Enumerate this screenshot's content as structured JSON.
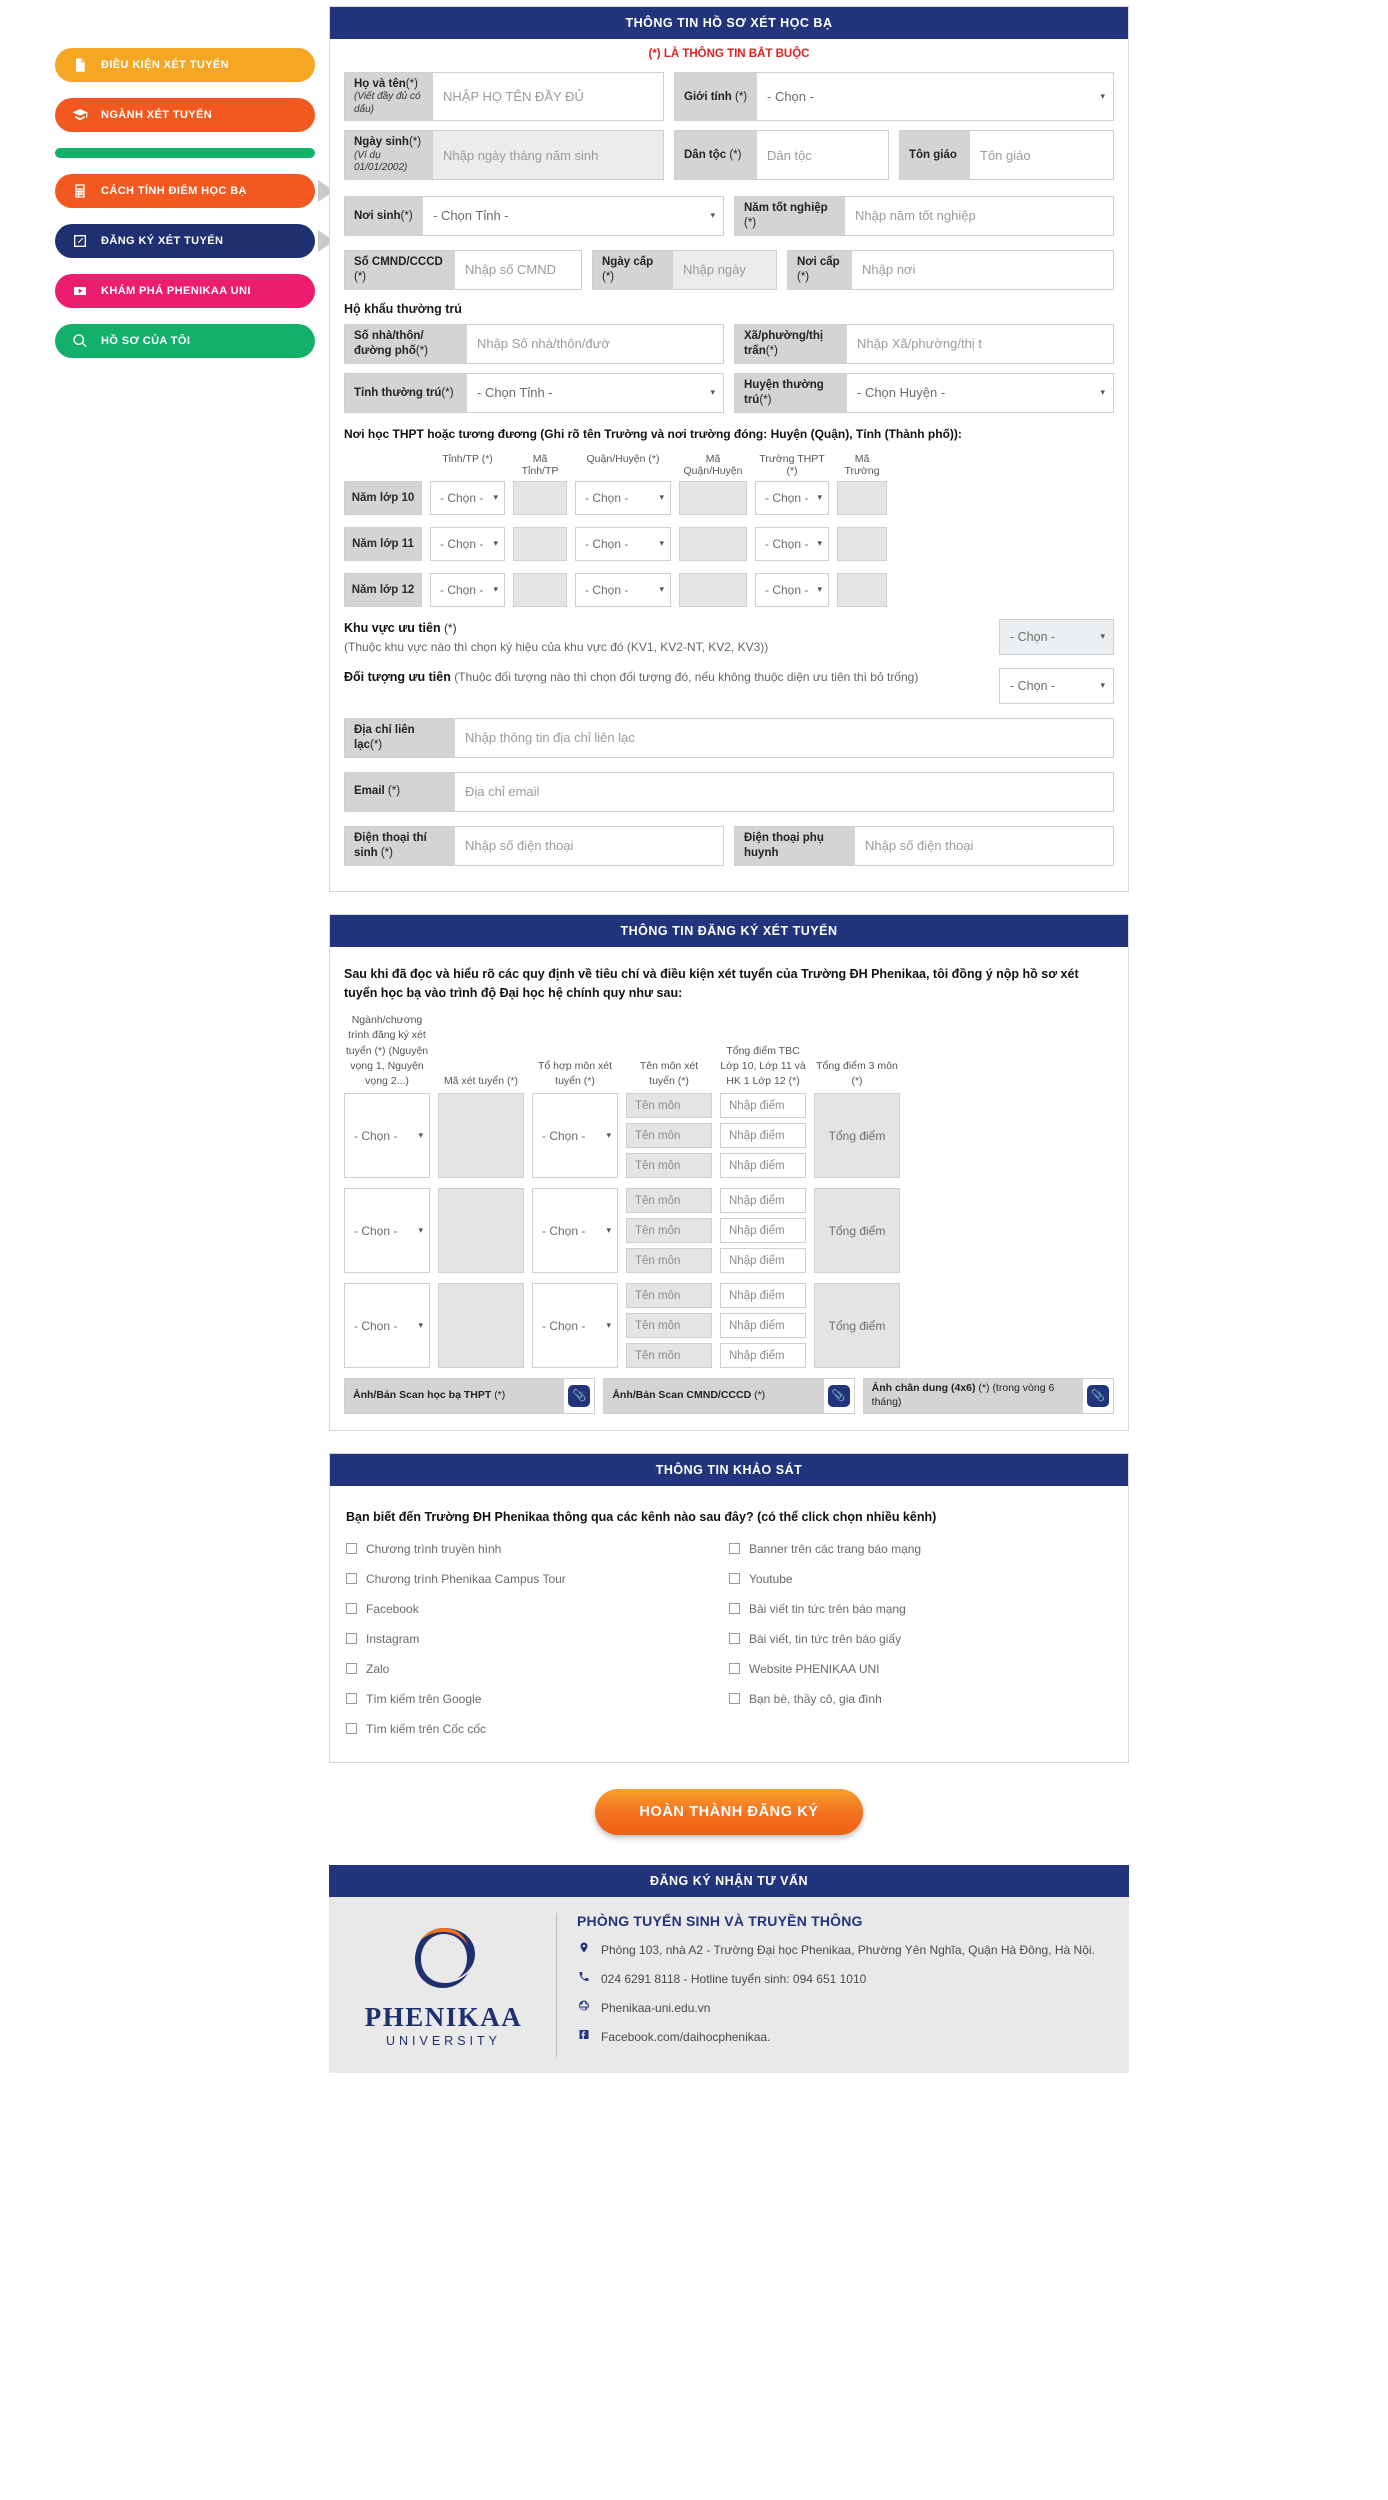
{
  "sidebar": {
    "items": [
      {
        "label": "Điều kiện xét tuyển",
        "icon": "document-icon",
        "color": "amber",
        "pointer": false
      },
      {
        "label": "Ngành xét tuyển",
        "icon": "graduation-cap-icon",
        "color": "orange",
        "pointer": false
      },
      {
        "label": "Cách tính điểm học bạ",
        "icon": "calculator-icon",
        "color": "orange",
        "pointer": true
      },
      {
        "label": "Đăng ký xét tuyển",
        "icon": "edit-pencil-icon",
        "color": "navy",
        "pointer": true
      },
      {
        "label": "Khám phá PHENIKAA UNI",
        "icon": "video-play-icon",
        "color": "pink",
        "pointer": false
      },
      {
        "label": "Hồ sơ của tôi",
        "icon": "search-icon",
        "color": "green",
        "pointer": false
      }
    ]
  },
  "section1": {
    "title": "THÔNG TIN HỒ SƠ XÉT HỌC BẠ",
    "required_note": "(*) LÀ THÔNG TIN BẮT BUỘC",
    "fullname": {
      "label": "Họ và tên",
      "star": "(*)",
      "sub": "(Viết đầy đủ có dấu)",
      "placeholder": "NHẬP HỌ TÊN ĐẦY ĐỦ"
    },
    "gender": {
      "label": "Giới tính",
      "star": "(*)",
      "value": "- Chọn -"
    },
    "birthday": {
      "label": "Ngày sinh",
      "star": "(*)",
      "sub": "(Ví dụ 01/01/2002)",
      "placeholder": "Nhập ngày tháng năm sinh"
    },
    "ethnicity": {
      "label": "Dân tộc",
      "star": "(*)",
      "placeholder": "Dân tộc"
    },
    "religion": {
      "label": "Tôn giáo",
      "star": "",
      "placeholder": "Tôn giáo"
    },
    "birthplace": {
      "label": "Nơi sinh",
      "star": "(*)",
      "value": "- Chọn Tỉnh -"
    },
    "grad_year": {
      "label": "Năm tốt nghiệp",
      "star": "(*)",
      "placeholder": "Nhập năm tốt nghiệp"
    },
    "id_number": {
      "label": "Số CMND/CCCD",
      "star": "(*)",
      "placeholder": "Nhập số CMND"
    },
    "id_date": {
      "label": "Ngày cấp",
      "star": "(*)",
      "placeholder": "Nhập ngày"
    },
    "id_place": {
      "label": "Nơi cấp",
      "star": "(*)",
      "placeholder": "Nhập nơi"
    },
    "residence_title": "Hộ khẩu thường trú",
    "street": {
      "label": "Số nhà/thôn/đường phố",
      "star": "(*)",
      "placeholder": "Nhập Số nhà/thôn/đườ"
    },
    "ward": {
      "label": "Xã/phường/thị trấn",
      "star": "(*)",
      "placeholder": "Nhập Xã/phường/thị t"
    },
    "province": {
      "label": "Tỉnh thường trú",
      "star": "(*)",
      "value": "- Chọn Tỉnh -"
    },
    "district": {
      "label": "Huyện thường trú",
      "star": "(*)",
      "value": "- Chọn Huyện -"
    },
    "school_note": "Nơi học THPT hoặc tương đương (Ghi rõ tên Trường và nơi trường đóng: Huyện (Quận), Tỉnh (Thành phố)):",
    "school_headers": [
      "Tỉnh/TP (*)",
      "Mã Tỉnh/TP",
      "Quận/Huyện (*)",
      "Mã Quận/Huyện",
      "Trường THPT (*)",
      "Mã Trường"
    ],
    "school_rows": [
      {
        "grade": "Năm lớp 10",
        "province": "- Chọn -",
        "district": "- Chọn -",
        "school": "- Chọn -"
      },
      {
        "grade": "Năm lớp 11",
        "province": "- Chọn -",
        "district": "- Chọn -",
        "school": "- Chọn -"
      },
      {
        "grade": "Năm lớp 12",
        "province": "- Chọn -",
        "district": "- Chọn -",
        "school": "- Chọn -"
      }
    ],
    "priority_area": {
      "label": "Khu vực ưu tiên",
      "star": "(*)",
      "hint": "(Thuộc khu vực nào thì chọn ký hiệu của khu vực đó (KV1, KV2-NT, KV2, KV3))",
      "value": "- Chọn -"
    },
    "priority_subject": {
      "label": "Đối tượng ưu tiên",
      "hint": "(Thuộc đối tượng nào thì chọn đối tượng đó, nếu không thuộc diện ưu tiên thì bỏ trống)",
      "value": "- Chọn -"
    },
    "contact_address": {
      "label": "Địa chỉ liên lạc",
      "star": "(*)",
      "placeholder": "Nhập thông tin địa chỉ liên lạc"
    },
    "email": {
      "label": "Email",
      "star": "(*)",
      "placeholder": "Địa chỉ email"
    },
    "phone_student": {
      "label": "Điện thoại thí sinh",
      "star": "(*)",
      "placeholder": "Nhập số điện thoại"
    },
    "phone_parent": {
      "label": "Điện thoại phụ huynh",
      "star": "",
      "placeholder": "Nhập số điện thoại"
    }
  },
  "section2": {
    "title": "THÔNG TIN ĐĂNG KÝ XÉT TUYỂN",
    "declaration": "Sau khi đã đọc và hiểu rõ các quy định về tiêu chí và điều kiện xét tuyển của Trường ĐH Phenikaa, tôi đồng ý nộp hồ sơ xét tuyển học bạ vào trình độ Đại học hệ chính quy như sau:",
    "headers": {
      "program": "Ngành/chương trình đăng ký xét tuyển (*) (Nguyện vọng 1, Nguyện vọng 2...)",
      "code": "Mã xét tuyển (*)",
      "combo": "Tổ hợp môn xét tuyển (*)",
      "subject": "Tên môn xét tuyển (*)",
      "gpa": "Tổng điểm TBC Lớp 10, Lớp 11 và HK 1 Lớp 12 (*)",
      "total": "Tổng điểm 3 môn (*)"
    },
    "rows": [
      {
        "program": "- Chọn -",
        "combo": "- Chọn -",
        "subjects": [
          "Tên môn",
          "Tên môn",
          "Tên môn"
        ],
        "scores": [
          "Nhập điểm",
          "Nhập điểm",
          "Nhập điểm"
        ],
        "total": "Tổng điểm"
      },
      {
        "program": "- Chọn -",
        "combo": "- Chọn -",
        "subjects": [
          "Tên môn",
          "Tên môn",
          "Tên môn"
        ],
        "scores": [
          "Nhập điểm",
          "Nhập điểm",
          "Nhập điểm"
        ],
        "total": "Tổng điểm"
      },
      {
        "program": "- Chọn -",
        "combo": "- Chọn -",
        "subjects": [
          "Tên môn",
          "Tên môn",
          "Tên môn"
        ],
        "scores": [
          "Nhập điểm",
          "Nhập điểm",
          "Nhập điểm"
        ],
        "total": "Tổng điểm"
      }
    ],
    "uploads": [
      {
        "label": "Ảnh/Bản Scan học bạ THPT",
        "star": "(*)",
        "extra": "",
        "icon": "paperclip-icon"
      },
      {
        "label": "Ảnh/Bản Scan CMND/CCCD",
        "star": "(*)",
        "extra": "",
        "icon": "paperclip-icon"
      },
      {
        "label": "Ảnh chân dung (4x6)",
        "star": "(*)",
        "extra": "(trong vòng 6 tháng)",
        "icon": "paperclip-icon"
      }
    ]
  },
  "section3": {
    "title": "THÔNG TIN KHẢO SÁT",
    "question": "Bạn biết đến Trường ĐH Phenikaa thông qua các kênh nào sau đây? (có thể click chọn nhiều kênh)",
    "left_options": [
      "Chương trình truyền hình",
      "Chương trình Phenikaa Campus Tour",
      "Facebook",
      "Instagram",
      "Zalo",
      "Tìm kiếm trên Google",
      "Tìm kiếm trên Cốc cốc"
    ],
    "right_options": [
      "Banner trên các trang báo mạng",
      "Youtube",
      "Bài viết tin tức trên báo mạng",
      "Bài viết, tin tức trên báo giấy",
      "Website PHENIKAA UNI",
      "Bạn bè, thầy cô, gia đình"
    ]
  },
  "submit": {
    "label": "HOÀN THÀNH ĐĂNG KÝ"
  },
  "footer": {
    "title": "ĐĂNG KÝ NHẬN TƯ VẤN",
    "logo_name": "PHENIKAA",
    "logo_sub": "UNIVERSITY",
    "office": "PHÒNG TUYỂN SINH VÀ TRUYỀN THÔNG",
    "address": "Phòng 103, nhà A2 - Trường Đại học Phenikaa, Phường Yên Nghĩa, Quận Hà Đông, Hà Nội.",
    "phone": "024 6291 8118 - Hotline tuyển sinh: 094 651 1010",
    "website": "Phenikaa-uni.edu.vn",
    "facebook": "Facebook.com/daihocphenikaa."
  },
  "colors": {
    "navy": "#22347c",
    "orange": "#f37021",
    "amber": "#f5a623",
    "pink": "#ec1c6e",
    "green": "#13b06a",
    "required_red": "#e02020"
  }
}
